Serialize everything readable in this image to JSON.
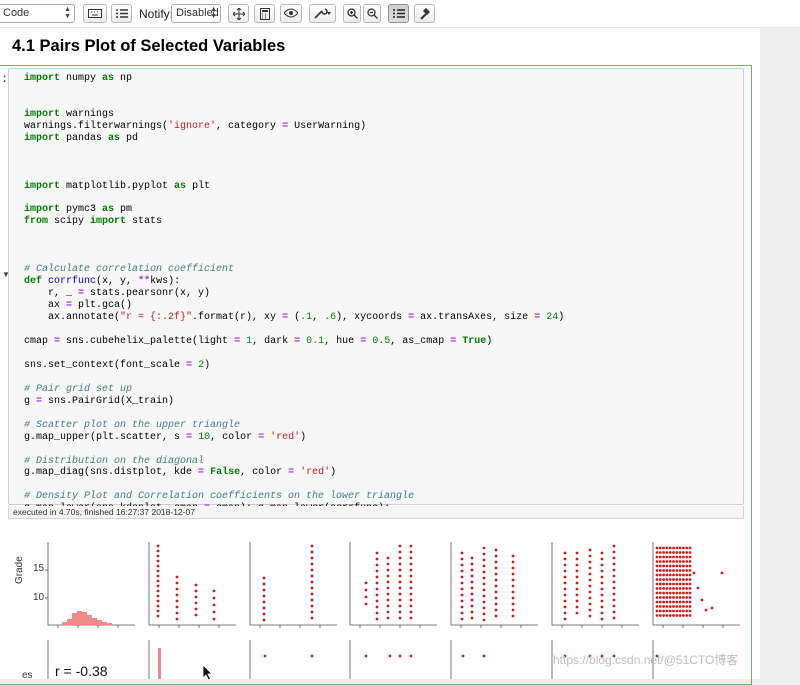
{
  "toolbar": {
    "cell_type": "Code",
    "notify_label": "Notify:",
    "notify_value": "Disabled",
    "buttons": [
      "keyboard-icon",
      "list-icon",
      "move-icon",
      "calculator-icon",
      "eye-icon",
      "wrench-icon",
      "zoom-in-icon",
      "zoom-out-icon",
      "table-of-contents-icon",
      "hammer-icon"
    ]
  },
  "notebook": {
    "heading": "4.1  Pairs Plot of Selected Variables",
    "prompt": ":",
    "code_lines": [
      "import numpy as np",
      "",
      "",
      "import warnings",
      "warnings.filterwarnings('ignore', category = UserWarning)",
      "import pandas as pd",
      "",
      "",
      "",
      "import matplotlib.pyplot as plt",
      "",
      "import pymc3 as pm",
      "from scipy import stats",
      "",
      "",
      "",
      "# Calculate correlation coefficient",
      "def corrfunc(x, y, **kws):",
      "    r, _ = stats.pearsonr(x, y)",
      "    ax = plt.gca()",
      "    ax.annotate(\"r = {:.2f}\".format(r), xy = (.1, .6), xycoords = ax.transAxes, size = 24)",
      "",
      "cmap = sns.cubehelix_palette(light = 1, dark = 0.1, hue = 0.5, as_cmap = True)",
      "",
      "sns.set_context(font_scale = 2)",
      "",
      "# Pair grid set up",
      "g = sns.PairGrid(X_train)",
      "",
      "# Scatter plot on the upper triangle",
      "g.map_upper(plt.scatter, s = 10, color = 'red')",
      "",
      "# Distribution on the diagonal",
      "g.map_diag(sns.distplot, kde = False, color = 'red')",
      "",
      "# Density Plot and Correlation coefficients on the lower triangle",
      "g.map_lower(sns.kdeplot, cmap = cmap); g.map_lower(corrfunc);"
    ],
    "exec_info": "executed in 4.70s, finished 16:27:37 2018-12-07"
  },
  "output": {
    "y_label_top": "Grade",
    "y_ticks": [
      "15",
      "10"
    ],
    "y_label_bottom": "es",
    "correlation_text": "r = -0.38",
    "colors": {
      "scatter": "#d01c1c",
      "hist": "#f08a8a"
    }
  },
  "watermark": "https://blog.csdn.net/@51CTO博客"
}
